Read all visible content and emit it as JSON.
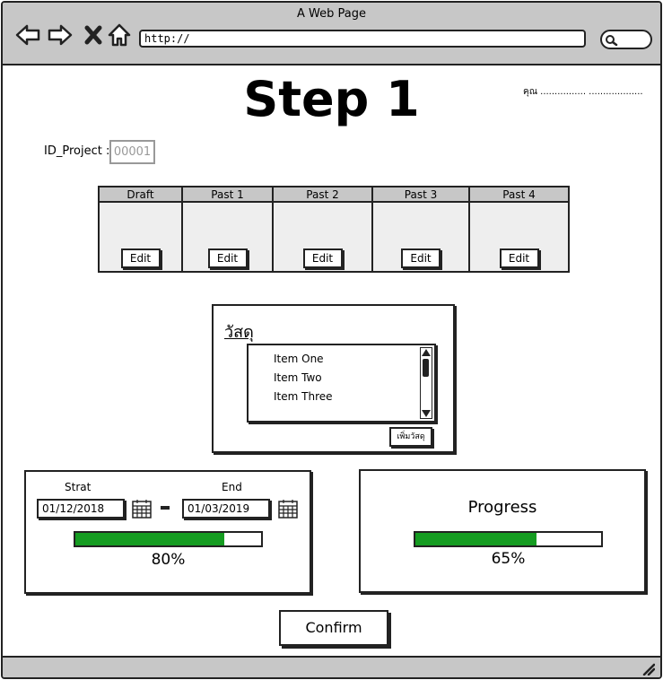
{
  "browser": {
    "title": "A Web Page",
    "url": "http://"
  },
  "page": {
    "title": "Step 1",
    "user_line": "คุณ ................  ...................",
    "project": {
      "label": "ID_Project :",
      "value": "00001"
    }
  },
  "phases": {
    "columns": [
      "Draft",
      "Past 1",
      "Past 2",
      "Past 3",
      "Past 4"
    ],
    "edit_label": "Edit"
  },
  "materials": {
    "title": "วัสดุ",
    "items": [
      "Item One",
      "Item Two",
      "Item Three"
    ],
    "add_label": "เพิ่มวัสดุ"
  },
  "schedule": {
    "start_label": "Strat",
    "end_label": "End",
    "start_date": "01/12/2018",
    "end_date": "01/03/2019",
    "progress": 0.8,
    "progress_text": "80%"
  },
  "progress_panel": {
    "title": "Progress",
    "progress": 0.65,
    "progress_text": "65%"
  },
  "confirm_label": "Confirm",
  "colors": {
    "progress_fill": "#159c21",
    "chrome": "#c7c7c7"
  }
}
